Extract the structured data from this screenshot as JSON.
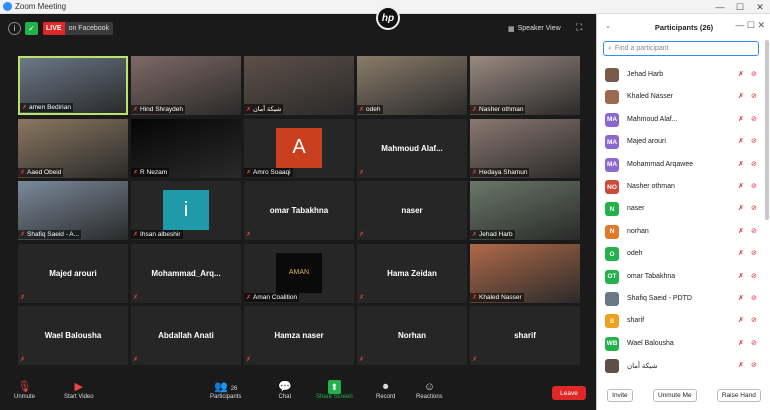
{
  "window": {
    "title": "Zoom Meeting",
    "controls": [
      "—",
      "☐",
      "✕"
    ]
  },
  "topbar": {
    "live_badge": "LIVE",
    "live_target": "on Facebook",
    "brand": "hp",
    "speaker_view": "Speaker View"
  },
  "tiles": [
    {
      "name": "ameen",
      "label": "amen Bedirian",
      "bg": "#6a7888",
      "active": true
    },
    {
      "name": "hind",
      "label": "Hind Shraydeh",
      "bg": "#7e6a66"
    },
    {
      "name": "arabic",
      "label": "شيكة أمان",
      "bg": "#5e5048"
    },
    {
      "name": "odeh",
      "label": "odeh",
      "bg": "#8a7c6a"
    },
    {
      "name": "nasher",
      "label": "Nasher othman",
      "bg": "#9a8a80"
    },
    {
      "name": "aaed",
      "label": "Aaed Obeid",
      "bg": "#8a7860"
    },
    {
      "name": "rnezam",
      "label": "R Nezam",
      "bg": "#050505"
    },
    {
      "name": "amro",
      "label": "Amro Soaaqi",
      "letter": "A",
      "letter_bg": "#c8401e"
    },
    {
      "name": "mahmoud",
      "label": "Mahmoud Alaf...",
      "big": true
    },
    {
      "name": "ledaya",
      "label": "Hedaya Shamun",
      "bg": "#8a7870"
    },
    {
      "name": "shafiq",
      "label": "Shafiq Saeid - A...",
      "bg": "#7a8a9a"
    },
    {
      "name": "ihsan",
      "label": "Ihsan albeshir",
      "letter": "i",
      "letter_bg": "#1e9aa8"
    },
    {
      "name": "omar",
      "label": "omar Tabakhna",
      "big": true
    },
    {
      "name": "naser",
      "label": "naser",
      "big": true
    },
    {
      "name": "jehad",
      "label": "Jehad Harb",
      "bg": "#6a7868"
    },
    {
      "name": "majed",
      "label": "Majed arouri",
      "big": true
    },
    {
      "name": "mohammad",
      "label": "Mohammad_Arq...",
      "big": true
    },
    {
      "name": "aman",
      "label": "Aman Coalition",
      "logo": "AMAN",
      "logo_bg": "#0a0a0a"
    },
    {
      "name": "hama",
      "label": "Hama Zeidan",
      "big": true
    },
    {
      "name": "khaled",
      "label": "Khaled Nasser",
      "bg": "#b06a48"
    },
    {
      "name": "wael",
      "label": "Wael Balousha",
      "big": true
    },
    {
      "name": "abdallah",
      "label": "Abdallah Anati",
      "big": true
    },
    {
      "name": "hamza",
      "label": "Hamza naser",
      "big": true
    },
    {
      "name": "norhan",
      "label": "Norhan",
      "big": true
    },
    {
      "name": "sharif",
      "label": "sharif",
      "big": true
    }
  ],
  "toolbar": {
    "unmute": "Unmute",
    "start_video": "Start Video",
    "participants": "Participants",
    "participants_count": "26",
    "chat": "Chat",
    "share_screen": "Share Screen",
    "record": "Record",
    "reactions": "Reactions",
    "leave": "Leave"
  },
  "panel": {
    "title": "Participants (26)",
    "search_placeholder": "Find a participant",
    "participants": [
      {
        "name": "Jehad Harb",
        "avatar": "",
        "color": "#7a5a48"
      },
      {
        "name": "Khaled Nasser",
        "avatar": "",
        "color": "#9a6a50"
      },
      {
        "name": "Mahmoud Alaf...",
        "avatar": "MA",
        "color": "#8a6ad0"
      },
      {
        "name": "Majed arouri",
        "avatar": "MA",
        "color": "#8a6ad0"
      },
      {
        "name": "Mohammad Arqawee",
        "avatar": "MA",
        "color": "#8a6ad0"
      },
      {
        "name": "Nasher othman",
        "avatar": "NO",
        "color": "#d04a3a"
      },
      {
        "name": "naser",
        "avatar": "N",
        "color": "#23b14d"
      },
      {
        "name": "norhan",
        "avatar": "N",
        "color": "#e07a2a"
      },
      {
        "name": "odeh",
        "avatar": "O",
        "color": "#23b14d"
      },
      {
        "name": "omar Tabakhna",
        "avatar": "OT",
        "color": "#23b14d"
      },
      {
        "name": "Shafiq Saeid - PDTD",
        "avatar": "",
        "color": "#6a7888"
      },
      {
        "name": "sharif",
        "avatar": "S",
        "color": "#f0a020"
      },
      {
        "name": "Wael Balousha",
        "avatar": "WB",
        "color": "#23b14d"
      },
      {
        "name": "شيكة أمان",
        "avatar": "",
        "color": "#5e5048"
      }
    ],
    "invite": "Invite",
    "unmute_me": "Unmute Me",
    "raise_hand": "Raise Hand"
  }
}
